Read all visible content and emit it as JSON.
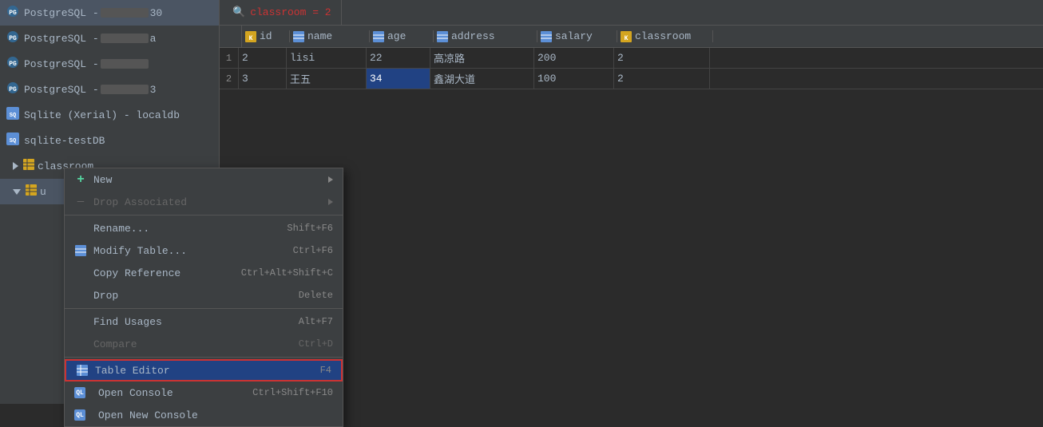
{
  "sidebar": {
    "items": [
      {
        "id": "pg1",
        "type": "postgresql",
        "label": "PostgreSQL -",
        "masked": true,
        "masked_suffix": "30"
      },
      {
        "id": "pg2",
        "type": "postgresql",
        "label": "PostgreSQL -",
        "masked": true,
        "masked_suffix": "a"
      },
      {
        "id": "pg3",
        "type": "postgresql",
        "label": "PostgreSQL -",
        "masked": true,
        "masked_suffix": ""
      },
      {
        "id": "pg4",
        "type": "postgresql",
        "label": "PostgreSQL -",
        "masked": true,
        "masked_suffix": "3"
      },
      {
        "id": "sqlite1",
        "type": "sqlite_xerial",
        "label": "Sqlite (Xerial) - localdb"
      },
      {
        "id": "sqlite2",
        "type": "sqlite",
        "label": "sqlite-testDB"
      },
      {
        "id": "classroom_table",
        "type": "table",
        "label": "classroom",
        "indent": 1
      },
      {
        "id": "u_table",
        "type": "table",
        "label": "u",
        "indent": 1,
        "active": true
      }
    ]
  },
  "tab": {
    "filter_label": "classroom = 2"
  },
  "table": {
    "columns": [
      {
        "name": "id",
        "type": "key"
      },
      {
        "name": "name",
        "type": "text"
      },
      {
        "name": "age",
        "type": "number"
      },
      {
        "name": "address",
        "type": "text"
      },
      {
        "name": "salary",
        "type": "number"
      },
      {
        "name": "classroom",
        "type": "key"
      }
    ],
    "rows": [
      {
        "rownum": "1",
        "id": "2",
        "name": "lisi",
        "age": "22",
        "address": "高凉路",
        "salary": "200",
        "classroom": "2",
        "highlight_age": false
      },
      {
        "rownum": "2",
        "id": "3",
        "name": "王五",
        "age": "34",
        "address": "鑫湖大道",
        "salary": "100",
        "classroom": "2",
        "highlight_age": true
      }
    ]
  },
  "context_menu": {
    "items": [
      {
        "id": "new",
        "label": "New",
        "shortcut": "",
        "has_submenu": true,
        "icon": "plus",
        "disabled": false
      },
      {
        "id": "drop_associated",
        "label": "Drop Associated",
        "shortcut": "",
        "has_submenu": true,
        "icon": "dash",
        "disabled": true
      },
      {
        "id": "rename",
        "label": "Rename...",
        "shortcut": "Shift+F6",
        "has_submenu": false,
        "icon": "",
        "disabled": false
      },
      {
        "id": "modify_table",
        "label": "Modify Table...",
        "shortcut": "Ctrl+F6",
        "has_submenu": false,
        "icon": "table",
        "disabled": false
      },
      {
        "id": "copy_reference",
        "label": "Copy Reference",
        "shortcut": "Ctrl+Alt+Shift+C",
        "has_submenu": false,
        "icon": "",
        "disabled": false
      },
      {
        "id": "drop",
        "label": "Drop",
        "shortcut": "Delete",
        "has_submenu": false,
        "icon": "",
        "disabled": false
      },
      {
        "id": "find_usages",
        "label": "Find Usages",
        "shortcut": "Alt+F7",
        "has_submenu": false,
        "icon": "",
        "disabled": false
      },
      {
        "id": "compare",
        "label": "Compare",
        "shortcut": "Ctrl+D",
        "has_submenu": false,
        "icon": "",
        "disabled": true
      },
      {
        "id": "table_editor",
        "label": "Table Editor",
        "shortcut": "F4",
        "has_submenu": false,
        "icon": "table2",
        "disabled": false,
        "highlighted": true
      },
      {
        "id": "open_console",
        "label": "Open Console",
        "shortcut": "Ctrl+Shift+F10",
        "has_submenu": false,
        "icon": "ql",
        "disabled": false
      },
      {
        "id": "open_new_console",
        "label": "Open New Console",
        "shortcut": "",
        "has_submenu": false,
        "icon": "ql",
        "disabled": false
      }
    ]
  }
}
